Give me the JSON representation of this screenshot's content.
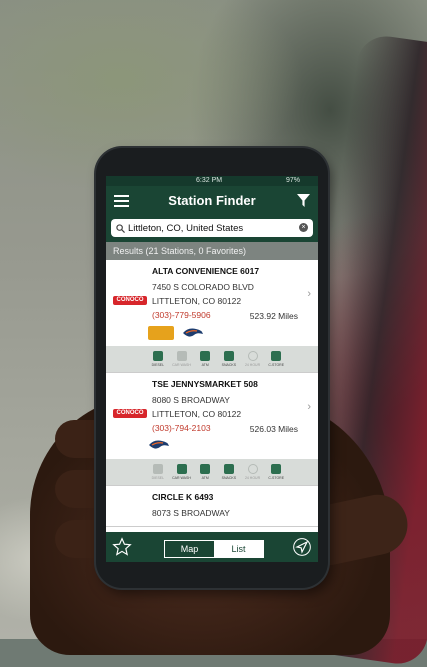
{
  "status": {
    "time": "6:32 PM",
    "battery": "97%"
  },
  "header": {
    "title": "Station Finder"
  },
  "search": {
    "value": "Littleton, CO, United States"
  },
  "results_label": "Results (21 Stations, 0 Favorites)",
  "stations": [
    {
      "name": "ALTA CONVENIENCE 6017",
      "address": "7450 S COLORADO BLVD",
      "city": "LITTLETON, CO 80122",
      "phone": "(303)-779-5906",
      "distance": "523.92 Miles",
      "brand": "CONOCO",
      "amenities": [
        {
          "label": "DIESEL",
          "on": true
        },
        {
          "label": "CAR WASH",
          "on": false
        },
        {
          "label": "ATM",
          "on": true
        },
        {
          "label": "SNACKS",
          "on": true
        },
        {
          "label": "24 HOUR",
          "on": false
        },
        {
          "label": "C-STORE",
          "on": true
        }
      ]
    },
    {
      "name": "TSE JENNYSMARKET 508",
      "address": "8080 S BROADWAY",
      "city": "LITTLETON, CO 80122",
      "phone": "(303)-794-2103",
      "distance": "526.03 Miles",
      "brand": "CONOCO",
      "amenities": [
        {
          "label": "DIESEL",
          "on": false
        },
        {
          "label": "CAR WASH",
          "on": true
        },
        {
          "label": "ATM",
          "on": true
        },
        {
          "label": "SNACKS",
          "on": true
        },
        {
          "label": "24 HOUR",
          "on": false
        },
        {
          "label": "C-STORE",
          "on": true
        }
      ]
    },
    {
      "name": "CIRCLE K 6493",
      "address": "8073 S BROADWAY"
    }
  ],
  "bottom": {
    "map": "Map",
    "list": "List"
  },
  "colors": {
    "header": "#1a4534",
    "phone_text": "#c0392b",
    "conoco": "#d7262b"
  }
}
